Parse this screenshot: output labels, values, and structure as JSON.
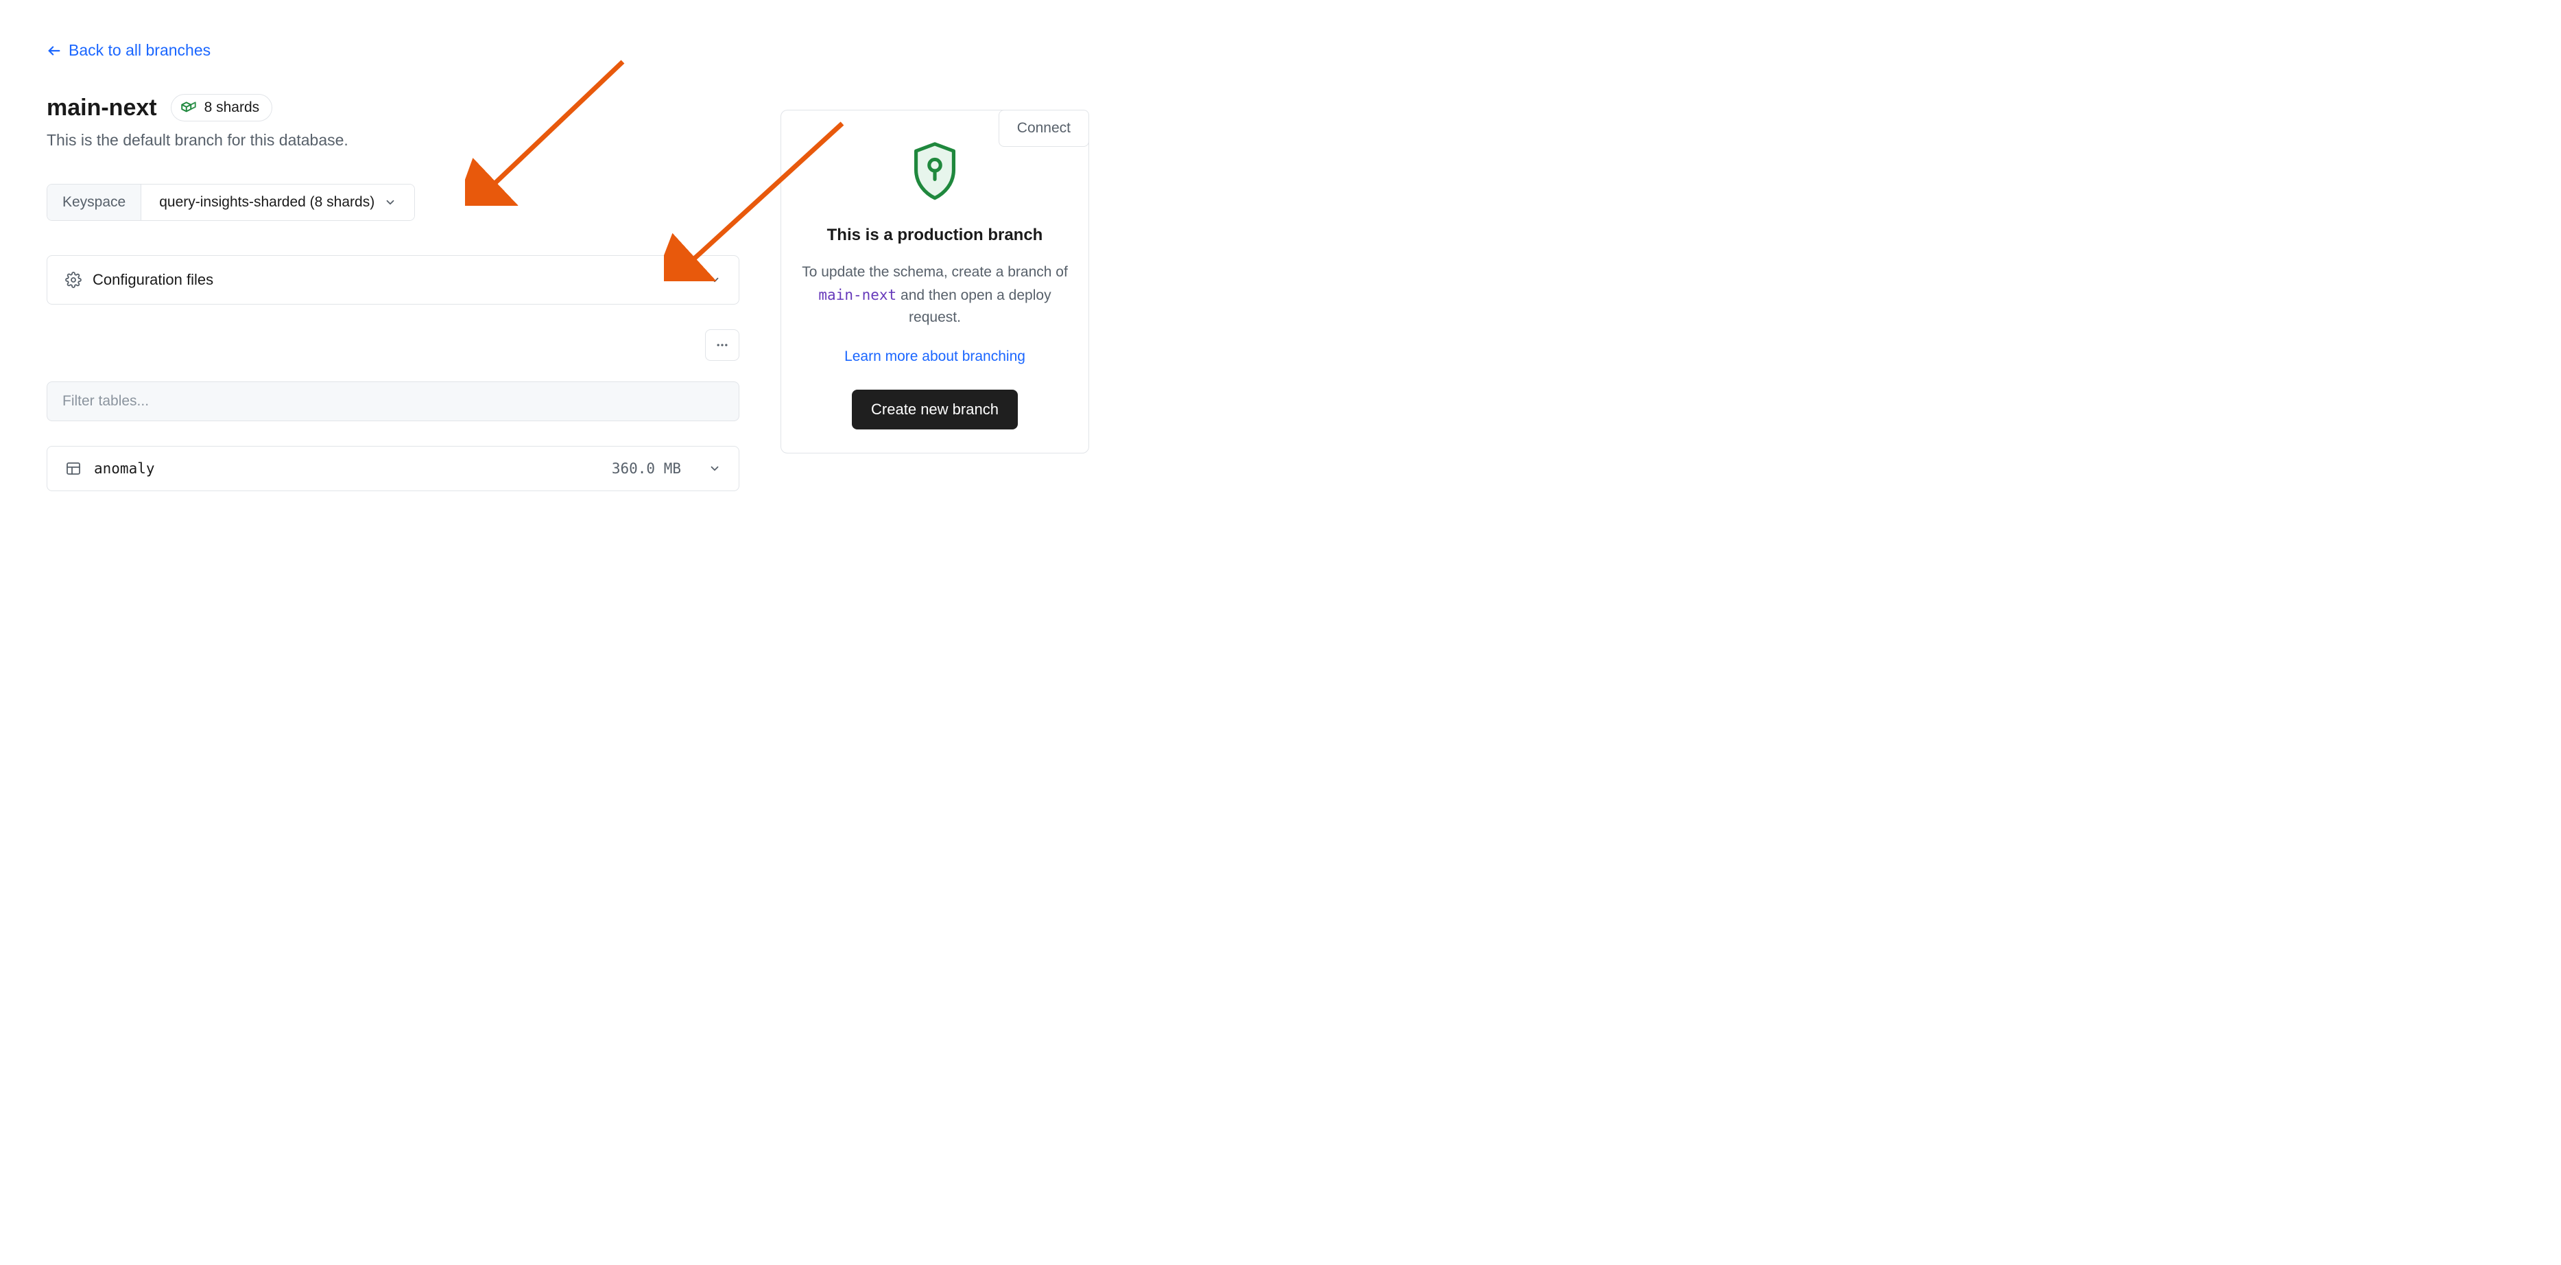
{
  "back_link": {
    "label": "Back to all branches"
  },
  "header": {
    "branch_name": "main-next",
    "shards_label": "8 shards",
    "description": "This is the default branch for this database.",
    "connect_label": "Connect"
  },
  "keyspace": {
    "label": "Keyspace",
    "selected": "query-insights-sharded (8 shards)"
  },
  "config_panel": {
    "title": "Configuration files"
  },
  "filter": {
    "placeholder": "Filter tables..."
  },
  "tables": [
    {
      "name": "anomaly",
      "size": "360.0 MB"
    }
  ],
  "production_card": {
    "title": "This is a production branch",
    "desc_before": "To update the schema, create a branch of ",
    "desc_code": "main-next",
    "desc_after": " and then open a deploy request.",
    "learn_label": "Learn more about branching",
    "create_label": "Create new branch"
  }
}
